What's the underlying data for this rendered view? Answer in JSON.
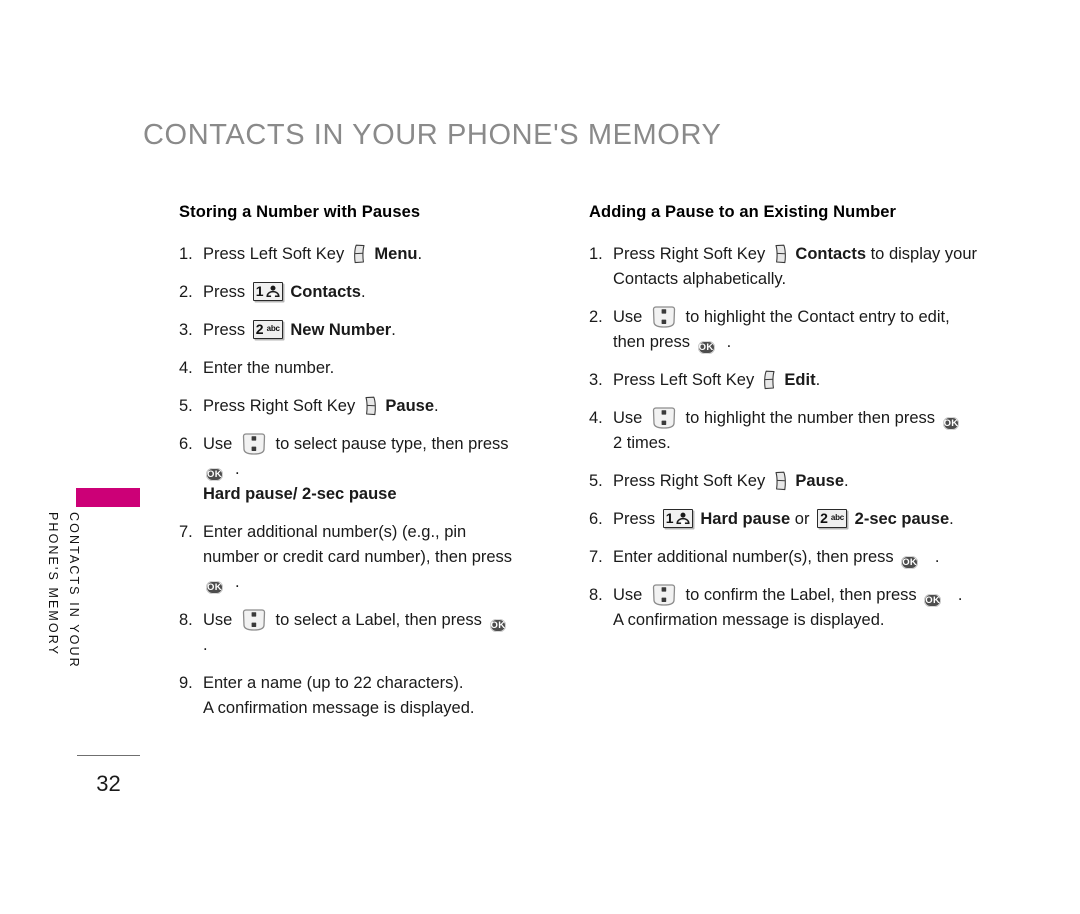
{
  "page": {
    "title": "CONTACTS IN YOUR PHONE'S MEMORY",
    "number": "32",
    "side_tab_line1": "CONTACTS IN YOUR",
    "side_tab_line2": "PHONE'S MEMORY",
    "accent_color": "#cc0077",
    "title_color": "#8a8a8a"
  },
  "icons": {
    "left_soft_key": "left-soft-key-icon",
    "right_soft_key": "right-soft-key-icon",
    "nav_key": "navigation-key-icon",
    "ok_key_label": "OK",
    "key1_digit": "1",
    "key1_glyph": "contacts-glyph",
    "key2_digit": "2",
    "key2_sub": "abc"
  },
  "left_column": {
    "heading": "Storing a Number with Pauses",
    "steps": [
      {
        "num": "1.",
        "parts": [
          {
            "t": "text",
            "v": "Press Left Soft Key "
          },
          {
            "t": "icon",
            "v": "left-soft-key"
          },
          {
            "t": "bold",
            "v": " Menu"
          },
          {
            "t": "text",
            "v": "."
          }
        ]
      },
      {
        "num": "2.",
        "parts": [
          {
            "t": "text",
            "v": "Press "
          },
          {
            "t": "icon",
            "v": "key-1"
          },
          {
            "t": "bold",
            "v": " Contacts"
          },
          {
            "t": "text",
            "v": "."
          }
        ]
      },
      {
        "num": "3.",
        "parts": [
          {
            "t": "text",
            "v": "Press "
          },
          {
            "t": "icon",
            "v": "key-2"
          },
          {
            "t": "bold",
            "v": " New Number"
          },
          {
            "t": "text",
            "v": "."
          }
        ]
      },
      {
        "num": "4.",
        "parts": [
          {
            "t": "text",
            "v": "Enter the number."
          }
        ]
      },
      {
        "num": "5.",
        "parts": [
          {
            "t": "text",
            "v": "Press Right Soft Key "
          },
          {
            "t": "icon",
            "v": "right-soft-key"
          },
          {
            "t": "bold",
            "v": " Pause"
          },
          {
            "t": "text",
            "v": "."
          }
        ]
      },
      {
        "num": "6.",
        "parts": [
          {
            "t": "text",
            "v": "Use "
          },
          {
            "t": "icon",
            "v": "nav-key"
          },
          {
            "t": "text",
            "v": " to select pause type, then press "
          },
          {
            "t": "icon",
            "v": "ok-key"
          },
          {
            "t": "text",
            "v": "."
          },
          {
            "t": "break",
            "v": ""
          },
          {
            "t": "bold",
            "v": "Hard pause/ 2-sec pause"
          }
        ]
      },
      {
        "num": "7.",
        "parts": [
          {
            "t": "text",
            "v": "Enter additional number(s) (e.g., pin number or credit card number), then press "
          },
          {
            "t": "icon",
            "v": "ok-key"
          },
          {
            "t": "text",
            "v": "."
          }
        ]
      },
      {
        "num": "8.",
        "parts": [
          {
            "t": "text",
            "v": "Use "
          },
          {
            "t": "icon",
            "v": "nav-key"
          },
          {
            "t": "text",
            "v": " to select a Label, then press "
          },
          {
            "t": "icon",
            "v": "ok-key"
          },
          {
            "t": "text",
            "v": " ."
          }
        ]
      },
      {
        "num": "9.",
        "parts": [
          {
            "t": "text",
            "v": "Enter a name (up to 22 characters)."
          },
          {
            "t": "break",
            "v": ""
          },
          {
            "t": "text",
            "v": "A confirmation message is displayed."
          }
        ]
      }
    ]
  },
  "right_column": {
    "heading": "Adding a Pause to an Existing Number",
    "steps": [
      {
        "num": "1.",
        "parts": [
          {
            "t": "text",
            "v": "Press Right Soft Key "
          },
          {
            "t": "icon",
            "v": "right-soft-key"
          },
          {
            "t": "bold",
            "v": " Contacts"
          },
          {
            "t": "text",
            "v": " to display your Contacts alphabetically."
          }
        ]
      },
      {
        "num": "2.",
        "parts": [
          {
            "t": "text",
            "v": "Use "
          },
          {
            "t": "icon",
            "v": "nav-key"
          },
          {
            "t": "text",
            "v": " to highlight the Contact entry to edit, then press "
          },
          {
            "t": "icon",
            "v": "ok-key"
          },
          {
            "t": "text",
            "v": "."
          }
        ]
      },
      {
        "num": "3.",
        "parts": [
          {
            "t": "text",
            "v": "Press Left Soft Key "
          },
          {
            "t": "icon",
            "v": "left-soft-key"
          },
          {
            "t": "bold",
            "v": " Edit"
          },
          {
            "t": "text",
            "v": "."
          }
        ]
      },
      {
        "num": "4.",
        "parts": [
          {
            "t": "text",
            "v": "Use "
          },
          {
            "t": "icon",
            "v": "nav-key"
          },
          {
            "t": "text",
            "v": " to highlight the number then press "
          },
          {
            "t": "icon",
            "v": "ok-key"
          },
          {
            "t": "text",
            "v": " 2 times."
          }
        ]
      },
      {
        "num": "5.",
        "parts": [
          {
            "t": "text",
            "v": "Press Right Soft Key "
          },
          {
            "t": "icon",
            "v": "right-soft-key"
          },
          {
            "t": "bold",
            "v": " Pause"
          },
          {
            "t": "text",
            "v": "."
          }
        ]
      },
      {
        "num": "6.",
        "parts": [
          {
            "t": "text",
            "v": "Press "
          },
          {
            "t": "icon",
            "v": "key-1"
          },
          {
            "t": "bold",
            "v": " Hard pause"
          },
          {
            "t": "text",
            "v": " or "
          },
          {
            "t": "icon",
            "v": "key-2"
          },
          {
            "t": "bold",
            "v": " 2-sec pause"
          },
          {
            "t": "text",
            "v": "."
          }
        ]
      },
      {
        "num": "7.",
        "parts": [
          {
            "t": "text",
            "v": "Enter additional number(s), then press "
          },
          {
            "t": "icon",
            "v": "ok-key"
          },
          {
            "t": "text",
            "v": " ."
          }
        ]
      },
      {
        "num": "8.",
        "parts": [
          {
            "t": "text",
            "v": "Use "
          },
          {
            "t": "icon",
            "v": "nav-key"
          },
          {
            "t": "text",
            "v": " to confirm the Label, then press "
          },
          {
            "t": "icon",
            "v": "ok-key"
          },
          {
            "t": "text",
            "v": " ."
          },
          {
            "t": "break",
            "v": ""
          },
          {
            "t": "text",
            "v": "A confirmation message is displayed."
          }
        ]
      }
    ]
  }
}
